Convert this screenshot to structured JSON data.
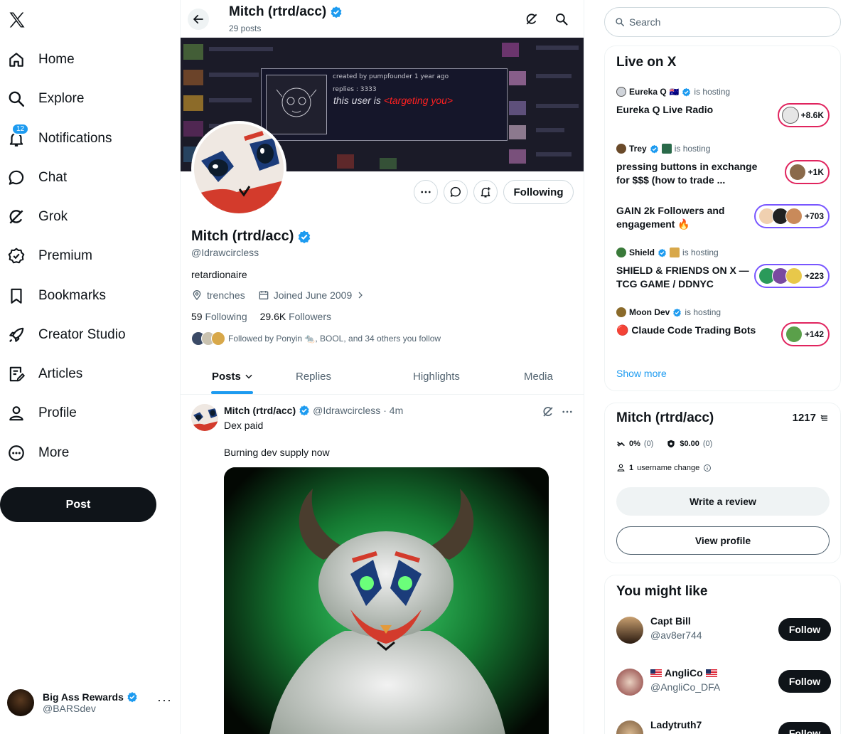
{
  "nav": {
    "items": [
      {
        "label": "Home",
        "icon": "home-icon"
      },
      {
        "label": "Explore",
        "icon": "search-icon"
      },
      {
        "label": "Notifications",
        "icon": "bell-icon",
        "badge": "12"
      },
      {
        "label": "Chat",
        "icon": "chat-icon"
      },
      {
        "label": "Grok",
        "icon": "grok-icon"
      },
      {
        "label": "Premium",
        "icon": "premium-icon"
      },
      {
        "label": "Bookmarks",
        "icon": "bookmark-icon"
      },
      {
        "label": "Creator Studio",
        "icon": "rocket-icon"
      },
      {
        "label": "Articles",
        "icon": "articles-icon"
      },
      {
        "label": "Profile",
        "icon": "person-icon"
      },
      {
        "label": "More",
        "icon": "more-circle-icon"
      }
    ],
    "post_label": "Post",
    "account": {
      "name": "Big Ass Rewards",
      "handle": "@BARSdev"
    }
  },
  "header": {
    "title": "Mitch (rtrd/acc)",
    "post_count": "29 posts"
  },
  "banner": {
    "meta": "created by  pumpfounder 1 year ago",
    "replies": "replies : 3333",
    "text_a": "this user is ",
    "text_b": "<targeting you>"
  },
  "profile": {
    "following_label": "Following",
    "name": "Mitch (rtrd/acc)",
    "handle": "@Idrawcircless",
    "bio": "retardionaire",
    "location": "trenches",
    "joined": "Joined June 2009",
    "following_count": "59",
    "following_word": "Following",
    "followers_count": "29.6K",
    "followers_word": "Followers",
    "followed_by": "Followed by Ponyin 🐀, BOOL, and 34 others you follow"
  },
  "tabs": [
    "Posts",
    "Replies",
    "Highlights",
    "Media"
  ],
  "tweet": {
    "name": "Mitch (rtrd/acc)",
    "handle": "@Idrawcircless",
    "time": "· 4m",
    "line1": "Dex paid",
    "line2": "Burning dev supply now"
  },
  "right": {
    "search_placeholder": "Search",
    "live": {
      "title": "Live on X",
      "hosting": "is hosting",
      "items": [
        {
          "host": "Eureka Q",
          "title": "Eureka Q Live Radio",
          "count": "+8.6K"
        },
        {
          "host": "Trey",
          "title": "pressing buttons in exchange for $$$ (how to trade ...",
          "count": "+1K"
        },
        {
          "host": "",
          "title": "GAIN 2k Followers and engagement 🔥",
          "count": "+703"
        },
        {
          "host": "Shield",
          "title": "SHIELD & FRIENDS ON X — TCG GAME / DDNYC",
          "count": "+223"
        },
        {
          "host": "Moon Dev",
          "title": "🔴 Claude Code Trading Bots",
          "count": "+142"
        }
      ],
      "show_more": "Show more"
    },
    "profile_card": {
      "name": "Mitch (rtrd/acc)",
      "score": "1217",
      "pct": "0%",
      "pct_count": "(0)",
      "usd": "$0.00",
      "usd_count": "(0)",
      "changes": "1",
      "changes_label": "username change",
      "write_review": "Write a review",
      "view_profile": "View profile"
    },
    "suggest": {
      "title": "You might like",
      "follow_label": "Follow",
      "users": [
        {
          "name": "Capt Bill",
          "handle": "@av8er744"
        },
        {
          "name": "AngliCo",
          "handle": "@AngliCo_DFA"
        },
        {
          "name": "Ladytruth7",
          "handle": ""
        }
      ]
    }
  },
  "colors": {
    "accent": "#1d9bf0",
    "text": "#0f1419",
    "muted": "#536471",
    "live_pink": "#e0245e",
    "live_purple": "#7856ff"
  }
}
